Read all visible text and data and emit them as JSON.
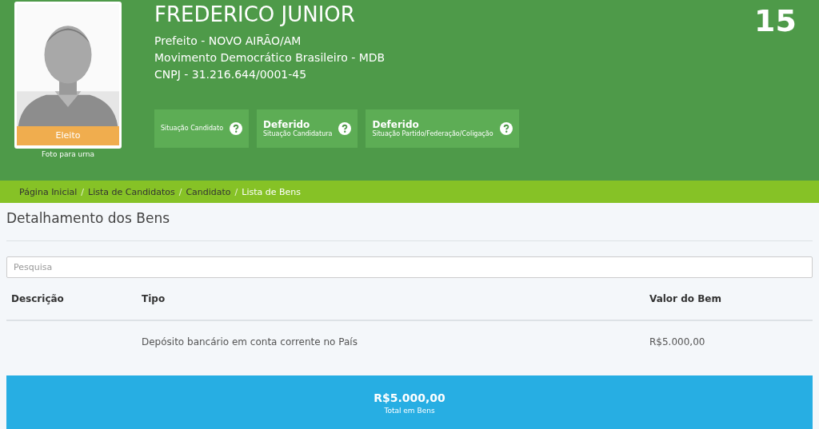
{
  "candidate": {
    "name": "FREDERICO JUNIOR",
    "number": "15",
    "lines": [
      "Prefeito - NOVO AIRÃO/AM",
      "Movimento Democrático Brasileiro - MDB",
      "CNPJ - 31.216.644/0001-45"
    ],
    "photo": {
      "kind": "picture",
      "status": "Eleito",
      "caption": "Foto para urna"
    }
  },
  "statuses": [
    {
      "label": "Situação Candidato"
    },
    {
      "value": "Deferido",
      "label": "Situação Candidatura"
    },
    {
      "value": "Deferido",
      "label": "Situação Partido/Federação/Coligação"
    }
  ],
  "breadcrumb": [
    {
      "label": "Página Inicial",
      "separator": "/",
      "current": false
    },
    {
      "label": "Lista de Candidatos",
      "separator": "/",
      "current": false
    },
    {
      "label": "Candidato",
      "separator": "/",
      "current": false
    },
    {
      "label": "Lista de Bens",
      "current": true
    }
  ],
  "section_title": "Detalhamento dos Bens",
  "search": {
    "placeholder": "Pesquisa"
  },
  "table": {
    "columns": [
      "Descrição",
      "Tipo",
      "Valor do Bem"
    ],
    "rows": [
      {
        "type": "Depósito bancário em conta corrente no País",
        "value": "R$5.000,00"
      }
    ]
  },
  "total": {
    "value": "R$5.000,00",
    "label": "Total em Bens"
  }
}
